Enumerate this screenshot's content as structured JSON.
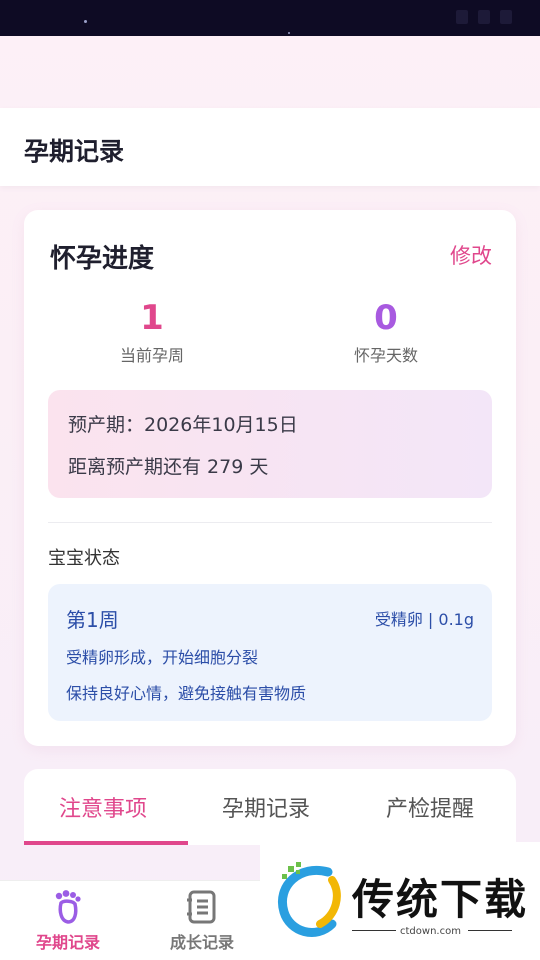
{
  "header": {
    "title": "孕期记录"
  },
  "progress_card": {
    "title": "怀孕进度",
    "edit_label": "修改",
    "current_week_value": "1",
    "current_week_label": "当前孕周",
    "pregnant_days_value": "0",
    "pregnant_days_label": "怀孕天数",
    "due_date_text": "预产期：2026年10月15日",
    "countdown_text": "距离预产期还有 279 天",
    "baby_status_title": "宝宝状态",
    "baby": {
      "week": "第1周",
      "size": "受精卵 | 0.1g",
      "development": "受精卵形成，开始细胞分裂",
      "tip": "保持良好心情，避免接触有害物质"
    }
  },
  "tabs": [
    {
      "label": "注意事项",
      "active": true
    },
    {
      "label": "孕期记录",
      "active": false
    },
    {
      "label": "产检提醒",
      "active": false
    }
  ],
  "bottom_nav": [
    {
      "label": "孕期记录",
      "icon": "footprint-icon",
      "active": true
    },
    {
      "label": "成长记录",
      "icon": "notebook-icon",
      "active": false
    }
  ],
  "watermark": {
    "title": "传统下载",
    "url": "ctdown.com"
  },
  "colors": {
    "accent": "#e0478c",
    "purple": "#a85ae0",
    "blue_text": "#2c4ea8",
    "status_bar": "#0e0b24"
  }
}
